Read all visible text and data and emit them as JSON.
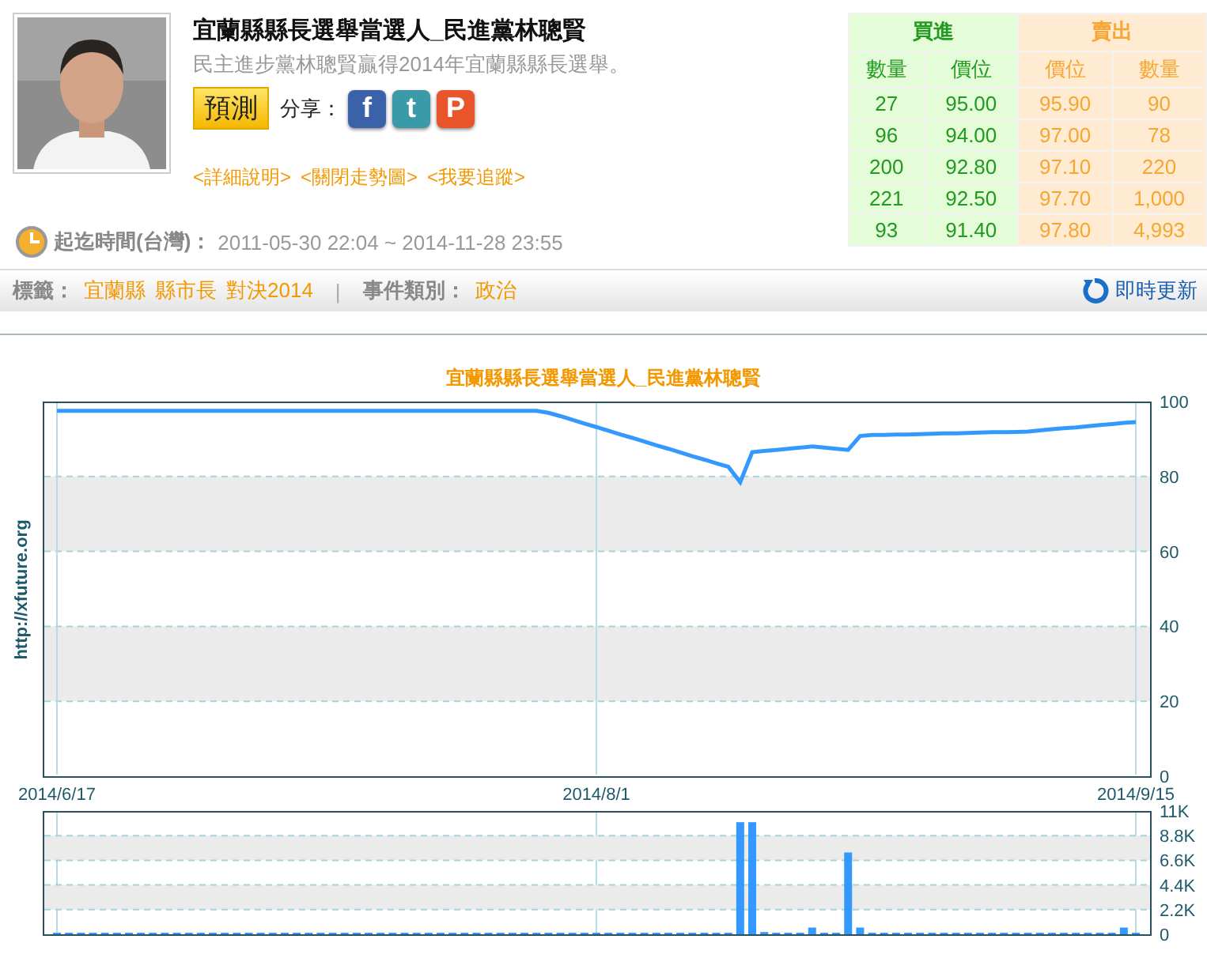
{
  "header": {
    "title": "宜蘭縣縣長選舉當選人_民進黨林聰賢",
    "subtitle": "民主進步黨林聰賢贏得2014年宜蘭縣縣長選舉。",
    "predict_button": "預測",
    "share_label": "分享：",
    "share_buttons": [
      {
        "glyph": "f",
        "color": "#3b62a8"
      },
      {
        "glyph": "t",
        "color": "#3a9aa8"
      },
      {
        "glyph": "P",
        "color": "#e8552a"
      }
    ],
    "links": [
      "<詳細說明>",
      "<關閉走勢圖>",
      "<我要追蹤>"
    ],
    "period": {
      "label": "起迄時間(台灣)：",
      "value": "2011-05-30 22:04 ~ 2014-11-28 23:55"
    }
  },
  "order_book": {
    "buy": {
      "title": "買進",
      "columns": [
        "數量",
        "價位"
      ],
      "rows": [
        [
          "27",
          "95.00"
        ],
        [
          "96",
          "94.00"
        ],
        [
          "200",
          "92.80"
        ],
        [
          "221",
          "92.50"
        ],
        [
          "93",
          "91.40"
        ]
      ]
    },
    "sell": {
      "title": "賣出",
      "columns": [
        "價位",
        "數量"
      ],
      "rows": [
        [
          "95.90",
          "90"
        ],
        [
          "97.00",
          "78"
        ],
        [
          "97.10",
          "220"
        ],
        [
          "97.70",
          "1,000"
        ],
        [
          "97.80",
          "4,993"
        ]
      ]
    }
  },
  "tag_bar": {
    "tags_label": "標籤：",
    "tags": [
      "宜蘭縣",
      "縣市長",
      "對決2014"
    ],
    "separator": "|",
    "category_label": "事件類別：",
    "category": "政治",
    "refresh": "即時更新"
  },
  "price_chart": {
    "chart_data": {
      "type": "line",
      "title": "宜蘭縣縣長選舉當選人_民進黨林聰賢",
      "ylabel": "http://xfuture.org",
      "categories": [
        "2014/6/17",
        null,
        null,
        null,
        null,
        null,
        null,
        null,
        null,
        null,
        null,
        null,
        null,
        null,
        null,
        null,
        null,
        null,
        null,
        null,
        null,
        null,
        null,
        null,
        null,
        null,
        null,
        null,
        null,
        null,
        null,
        null,
        null,
        null,
        null,
        null,
        null,
        null,
        null,
        null,
        null,
        null,
        null,
        null,
        null,
        "2014/8/1",
        null,
        null,
        null,
        null,
        null,
        null,
        null,
        null,
        null,
        null,
        null,
        null,
        null,
        null,
        null,
        null,
        null,
        null,
        null,
        null,
        null,
        null,
        null,
        null,
        null,
        null,
        null,
        null,
        null,
        null,
        null,
        null,
        null,
        null,
        null,
        null,
        null,
        null,
        null,
        null,
        null,
        null,
        null,
        null,
        "2014/9/15"
      ],
      "series": [
        {
          "color": "#3399ff",
          "values": [
            97.5,
            97.5,
            97.5,
            97.5,
            97.5,
            97.5,
            97.5,
            97.5,
            97.5,
            97.5,
            97.5,
            97.5,
            97.5,
            97.5,
            97.5,
            97.5,
            97.5,
            97.5,
            97.5,
            97.5,
            97.5,
            97.5,
            97.5,
            97.5,
            97.5,
            97.5,
            97.5,
            97.5,
            97.5,
            97.5,
            97.5,
            97.5,
            97.5,
            97.5,
            97.5,
            97.5,
            97.5,
            97.5,
            97.5,
            97.5,
            97.5,
            97.0,
            96.1,
            95.1,
            94.1,
            93.2,
            92.2,
            91.2,
            90.3,
            89.3,
            88.3,
            87.4,
            86.4,
            85.4,
            84.5,
            83.5,
            82.6,
            78.5,
            86.5,
            86.8,
            87.1,
            87.4,
            87.7,
            88.0,
            87.7,
            87.4,
            87.1,
            90.8,
            91.1,
            91.1,
            91.2,
            91.2,
            91.3,
            91.4,
            91.5,
            91.5,
            91.6,
            91.7,
            91.8,
            91.8,
            91.9,
            92.0,
            92.3,
            92.6,
            92.9,
            93.1,
            93.4,
            93.7,
            94.0,
            94.3,
            94.5
          ]
        }
      ],
      "grid": true,
      "ylim": [
        0,
        100
      ],
      "yticks": [
        0,
        20,
        40,
        60,
        80,
        100
      ]
    }
  },
  "volume_chart": {
    "chart_data": {
      "type": "bar",
      "categories": [
        null,
        null,
        null,
        null,
        null,
        null,
        null,
        null,
        null,
        null,
        null,
        null,
        null,
        null,
        null,
        null,
        null,
        null,
        null,
        null,
        null,
        null,
        null,
        null,
        null,
        null,
        null,
        null,
        null,
        null,
        null,
        null,
        null,
        null,
        null,
        null,
        null,
        null,
        null,
        null,
        null,
        null,
        null,
        null,
        null,
        null,
        null,
        null,
        null,
        null,
        null,
        null,
        null,
        null,
        null,
        null,
        null,
        null,
        null,
        null,
        null,
        null,
        null,
        null,
        null,
        null,
        null,
        null,
        null,
        null,
        null,
        null,
        null,
        null,
        null,
        null,
        null,
        null,
        null,
        null,
        null,
        null,
        null,
        null,
        null,
        null,
        null,
        null,
        null,
        null,
        null
      ],
      "series": [
        {
          "color": "#3399ff",
          "values": [
            0,
            0,
            0,
            0,
            0,
            0,
            0,
            0,
            0,
            0,
            0,
            0,
            0,
            0,
            0,
            0,
            0,
            0,
            0,
            0,
            0,
            0,
            0,
            0,
            0,
            0,
            0,
            0,
            0,
            0,
            0,
            0,
            0,
            0,
            0,
            0,
            0,
            0,
            0,
            0,
            0,
            0,
            0,
            0,
            0,
            0,
            0,
            0,
            0,
            0,
            0,
            0,
            0,
            0,
            0,
            0,
            0,
            10000,
            10000,
            200,
            0,
            0,
            0,
            600,
            0,
            0,
            7300,
            600,
            0,
            0,
            0,
            0,
            0,
            0,
            0,
            0,
            0,
            0,
            0,
            0,
            0,
            0,
            0,
            0,
            0,
            0,
            0,
            0,
            0,
            600,
            0
          ]
        }
      ],
      "grid": true,
      "ylim": [
        0,
        11000
      ],
      "yticks": [
        {
          "value": 0,
          "label": "0"
        },
        {
          "value": 2200,
          "label": "2.2K"
        },
        {
          "value": 4400,
          "label": "4.4K"
        },
        {
          "value": 6600,
          "label": "6.6K"
        },
        {
          "value": 8800,
          "label": "8.8K"
        },
        {
          "value": 11000,
          "label": "11K"
        }
      ]
    }
  }
}
